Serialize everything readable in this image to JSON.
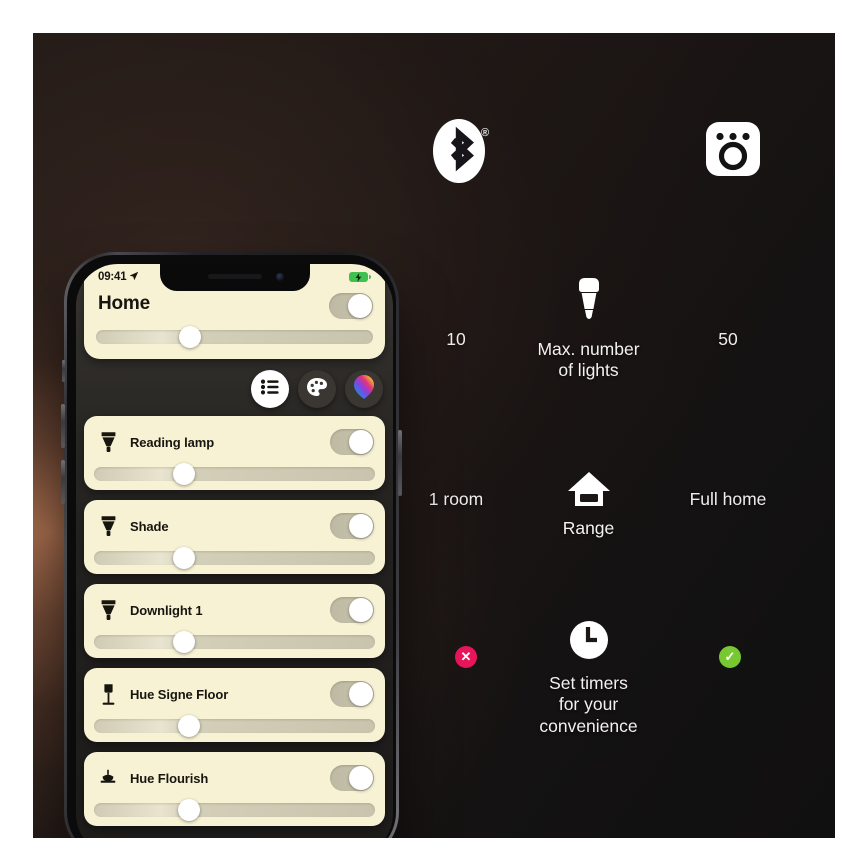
{
  "scene": {
    "background_dark": "#1a1614",
    "glow_color": "#ba7a56"
  },
  "phone": {
    "status_bar": {
      "time": "09:41",
      "location_icon": "location-arrow-icon",
      "battery_icon": "battery-charging-icon",
      "battery_color": "#3ec14e"
    },
    "home_card": {
      "title": "Home",
      "toggle_state": "on",
      "brightness_percent": 30
    },
    "mode_buttons": [
      {
        "name": "list-view-button",
        "icon": "list-icon",
        "active": true
      },
      {
        "name": "scenes-button",
        "icon": "palette-icon",
        "active": false
      },
      {
        "name": "color-picker-button",
        "icon": "color-wheel-icon",
        "active": false
      }
    ],
    "lights": [
      {
        "name": "Reading lamp",
        "icon": "bulb-spot-icon",
        "toggle_state": "on",
        "brightness_percent": 28
      },
      {
        "name": "Shade",
        "icon": "bulb-spot-icon",
        "toggle_state": "on",
        "brightness_percent": 28
      },
      {
        "name": "Downlight 1",
        "icon": "bulb-spot-icon",
        "toggle_state": "on",
        "brightness_percent": 28
      },
      {
        "name": "Hue Signe Floor",
        "icon": "floor-lamp-icon",
        "toggle_state": "on",
        "brightness_percent": 30
      },
      {
        "name": "Hue Flourish",
        "icon": "pendant-lamp-icon",
        "toggle_state": "on",
        "brightness_percent": 30
      }
    ]
  },
  "comparison": {
    "header": {
      "left_icon": "bluetooth-icon",
      "left_icon_registered_mark": "®",
      "right_icon": "hue-bridge-icon"
    },
    "rows": [
      {
        "left": "10",
        "center_icon": "light-bulb-icon",
        "center_label": "Max. number\nof lights",
        "center_line1": "Max. number",
        "center_line2": "of lights",
        "right": "50"
      },
      {
        "left": "1 room",
        "center_icon": "house-icon",
        "center_label": "Range",
        "center_line1": "Range",
        "center_line2": "",
        "right": "Full home"
      },
      {
        "left_badge": "✕",
        "left_badge_color": "#e8145c",
        "center_icon": "clock-icon",
        "center_line1": "Set timers",
        "center_line2": "for your",
        "center_line3": "convenience",
        "right_badge": "✓",
        "right_badge_color": "#78c832"
      }
    ]
  }
}
